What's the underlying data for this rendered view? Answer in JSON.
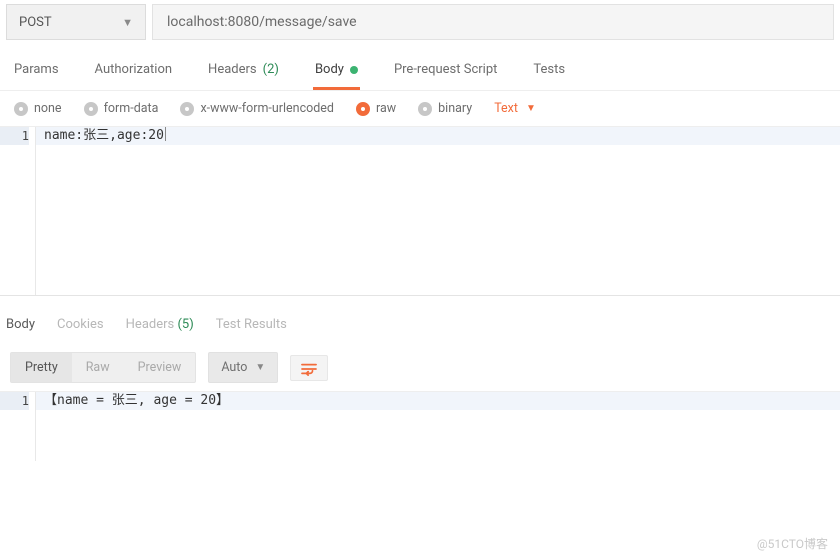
{
  "method": "POST",
  "url": "localhost:8080/message/save",
  "request_tabs": {
    "params": "Params",
    "auth": "Authorization",
    "headers_label": "Headers",
    "headers_count": "(2)",
    "body": "Body",
    "prerequest": "Pre-request Script",
    "tests": "Tests"
  },
  "body_types": {
    "none": "none",
    "formdata": "form-data",
    "urlenc": "x-www-form-urlencoded",
    "raw": "raw",
    "binary": "binary",
    "text": "Text"
  },
  "request_body_line1": "name:张三,age:20",
  "line_number_1": "1",
  "response_tabs": {
    "body": "Body",
    "cookies": "Cookies",
    "headers_label": "Headers",
    "headers_count": "(5)",
    "test_results": "Test Results"
  },
  "response_view": {
    "pretty": "Pretty",
    "raw": "Raw",
    "preview": "Preview",
    "auto": "Auto"
  },
  "response_body_line1": "【name = 张三, age = 20】",
  "watermark": "@51CTO博客"
}
